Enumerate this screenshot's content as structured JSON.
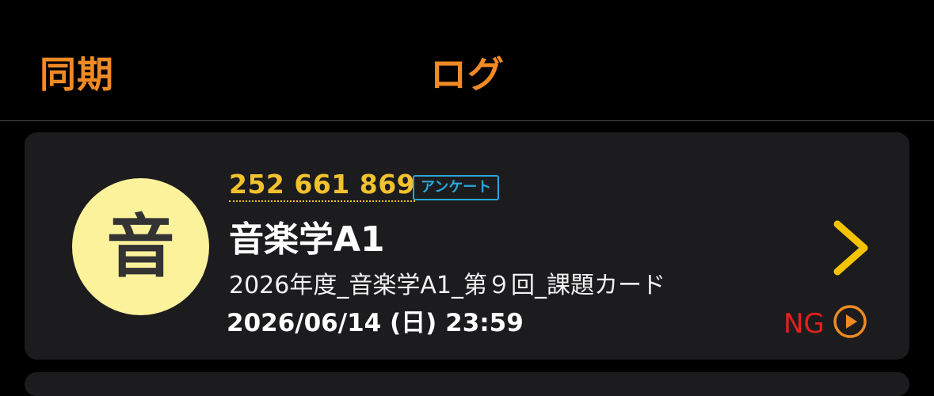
{
  "nav": {
    "left_label": "同期",
    "title": "ログ"
  },
  "assignment": {
    "avatar_char": "音",
    "code": "252 661 869",
    "badge": "アンケート",
    "course": "音楽学A1",
    "task": "2026年度_音楽学A1_第９回_課題カード",
    "deadline": "2026/06/14 (日) 23:59",
    "status": "NG",
    "icons": {
      "chevron": "chevron-right-icon",
      "play": "play-circle-icon"
    }
  },
  "colors": {
    "accent": "#f08a24",
    "code": "#f2c12e",
    "badge": "#2aa7d9",
    "avatar_bg": "#fcf29b",
    "ng": "#e4201b",
    "card_bg": "#1c1c1e"
  }
}
